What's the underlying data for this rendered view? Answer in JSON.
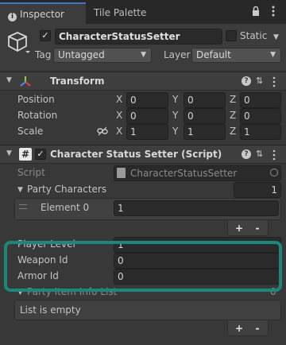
{
  "tabs": {
    "inspector": "Inspector",
    "tile_palette": "Tile Palette"
  },
  "object": {
    "name": "CharacterStatusSetter",
    "static_label": "Static",
    "tag_label": "Tag",
    "tag_value": "Untagged",
    "layer_label": "Layer",
    "layer_value": "Default"
  },
  "transform": {
    "title": "Transform",
    "position_label": "Position",
    "rotation_label": "Rotation",
    "scale_label": "Scale",
    "x": "X",
    "y": "Y",
    "z": "Z",
    "position": [
      "0",
      "0",
      "0"
    ],
    "rotation": [
      "0",
      "0",
      "0"
    ],
    "scale": [
      "1",
      "1",
      "1"
    ]
  },
  "component": {
    "title": "Character Status Setter (Script)",
    "script_label": "Script",
    "script_value": "CharacterStatusSetter",
    "party_characters_label": "Party Characters",
    "party_characters_count": "1",
    "element0_label": "Element 0",
    "element0_value": "1",
    "add": "+",
    "remove": "-",
    "player_level_label": "Player Level",
    "player_level_value": "1",
    "weapon_id_label": "Weapon Id",
    "weapon_id_value": "0",
    "armor_id_label": "Armor Id",
    "armor_id_value": "0",
    "party_item_label": "Party Item Info List",
    "party_item_count": "0",
    "list_empty": "List is empty"
  },
  "colors": {
    "highlight": "#19897a",
    "tab_accent": "#3a79bb"
  }
}
